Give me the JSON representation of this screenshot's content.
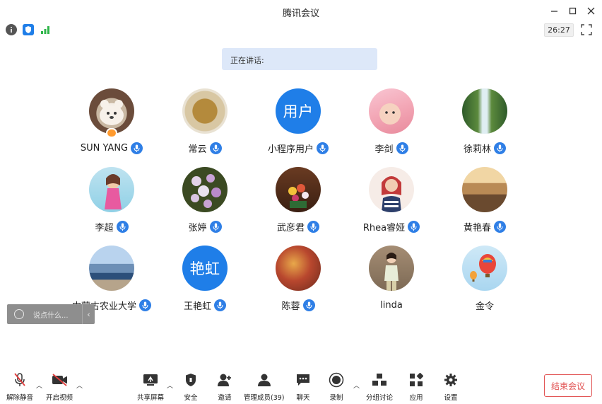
{
  "window": {
    "title": "腾讯会议"
  },
  "info_bar": {
    "timer": "26:27"
  },
  "speaking_banner": {
    "label": "正在讲话:"
  },
  "participants": [
    {
      "name": "SUN YANG",
      "avatar": "photo-bear",
      "host": true
    },
    {
      "name": "常云",
      "avatar": "photo-tea"
    },
    {
      "name": "小程序用户",
      "avatar_text": "用户"
    },
    {
      "name": "李剑",
      "avatar": "photo-baby"
    },
    {
      "name": "徐莉林",
      "avatar": "photo-waterfall"
    },
    {
      "name": "李超",
      "avatar": "photo-girl-cartoon"
    },
    {
      "name": "张婷",
      "avatar": "photo-flowers"
    },
    {
      "name": "武彦君",
      "avatar": "photo-bouquet"
    },
    {
      "name": "Rhea睿娅",
      "avatar": "photo-woman"
    },
    {
      "name": "黄艳春",
      "avatar": "photo-landscape"
    },
    {
      "name": "内蒙古农业大学",
      "avatar": "photo-coast"
    },
    {
      "name": "王艳虹",
      "avatar_text": "艳虹"
    },
    {
      "name": "陈蓉",
      "avatar": "photo-leaves"
    },
    {
      "name": "linda",
      "avatar": "photo-person"
    },
    {
      "name": "金令",
      "avatar": "photo-balloons"
    }
  ],
  "chat_input": {
    "placeholder": "说点什么..."
  },
  "toolbar": {
    "unmute": "解除静音",
    "start_video": "开启视频",
    "share_screen": "共享屏幕",
    "security": "安全",
    "invite": "邀请",
    "manage_members": "管理成员(39)",
    "chat": "聊天",
    "record": "录制",
    "breakout": "分组讨论",
    "apps": "应用",
    "settings": "设置",
    "end_meeting": "结束会议"
  },
  "colors": {
    "accent": "#1f7ee8",
    "end": "#e25454",
    "banner": "#dde8f9"
  }
}
